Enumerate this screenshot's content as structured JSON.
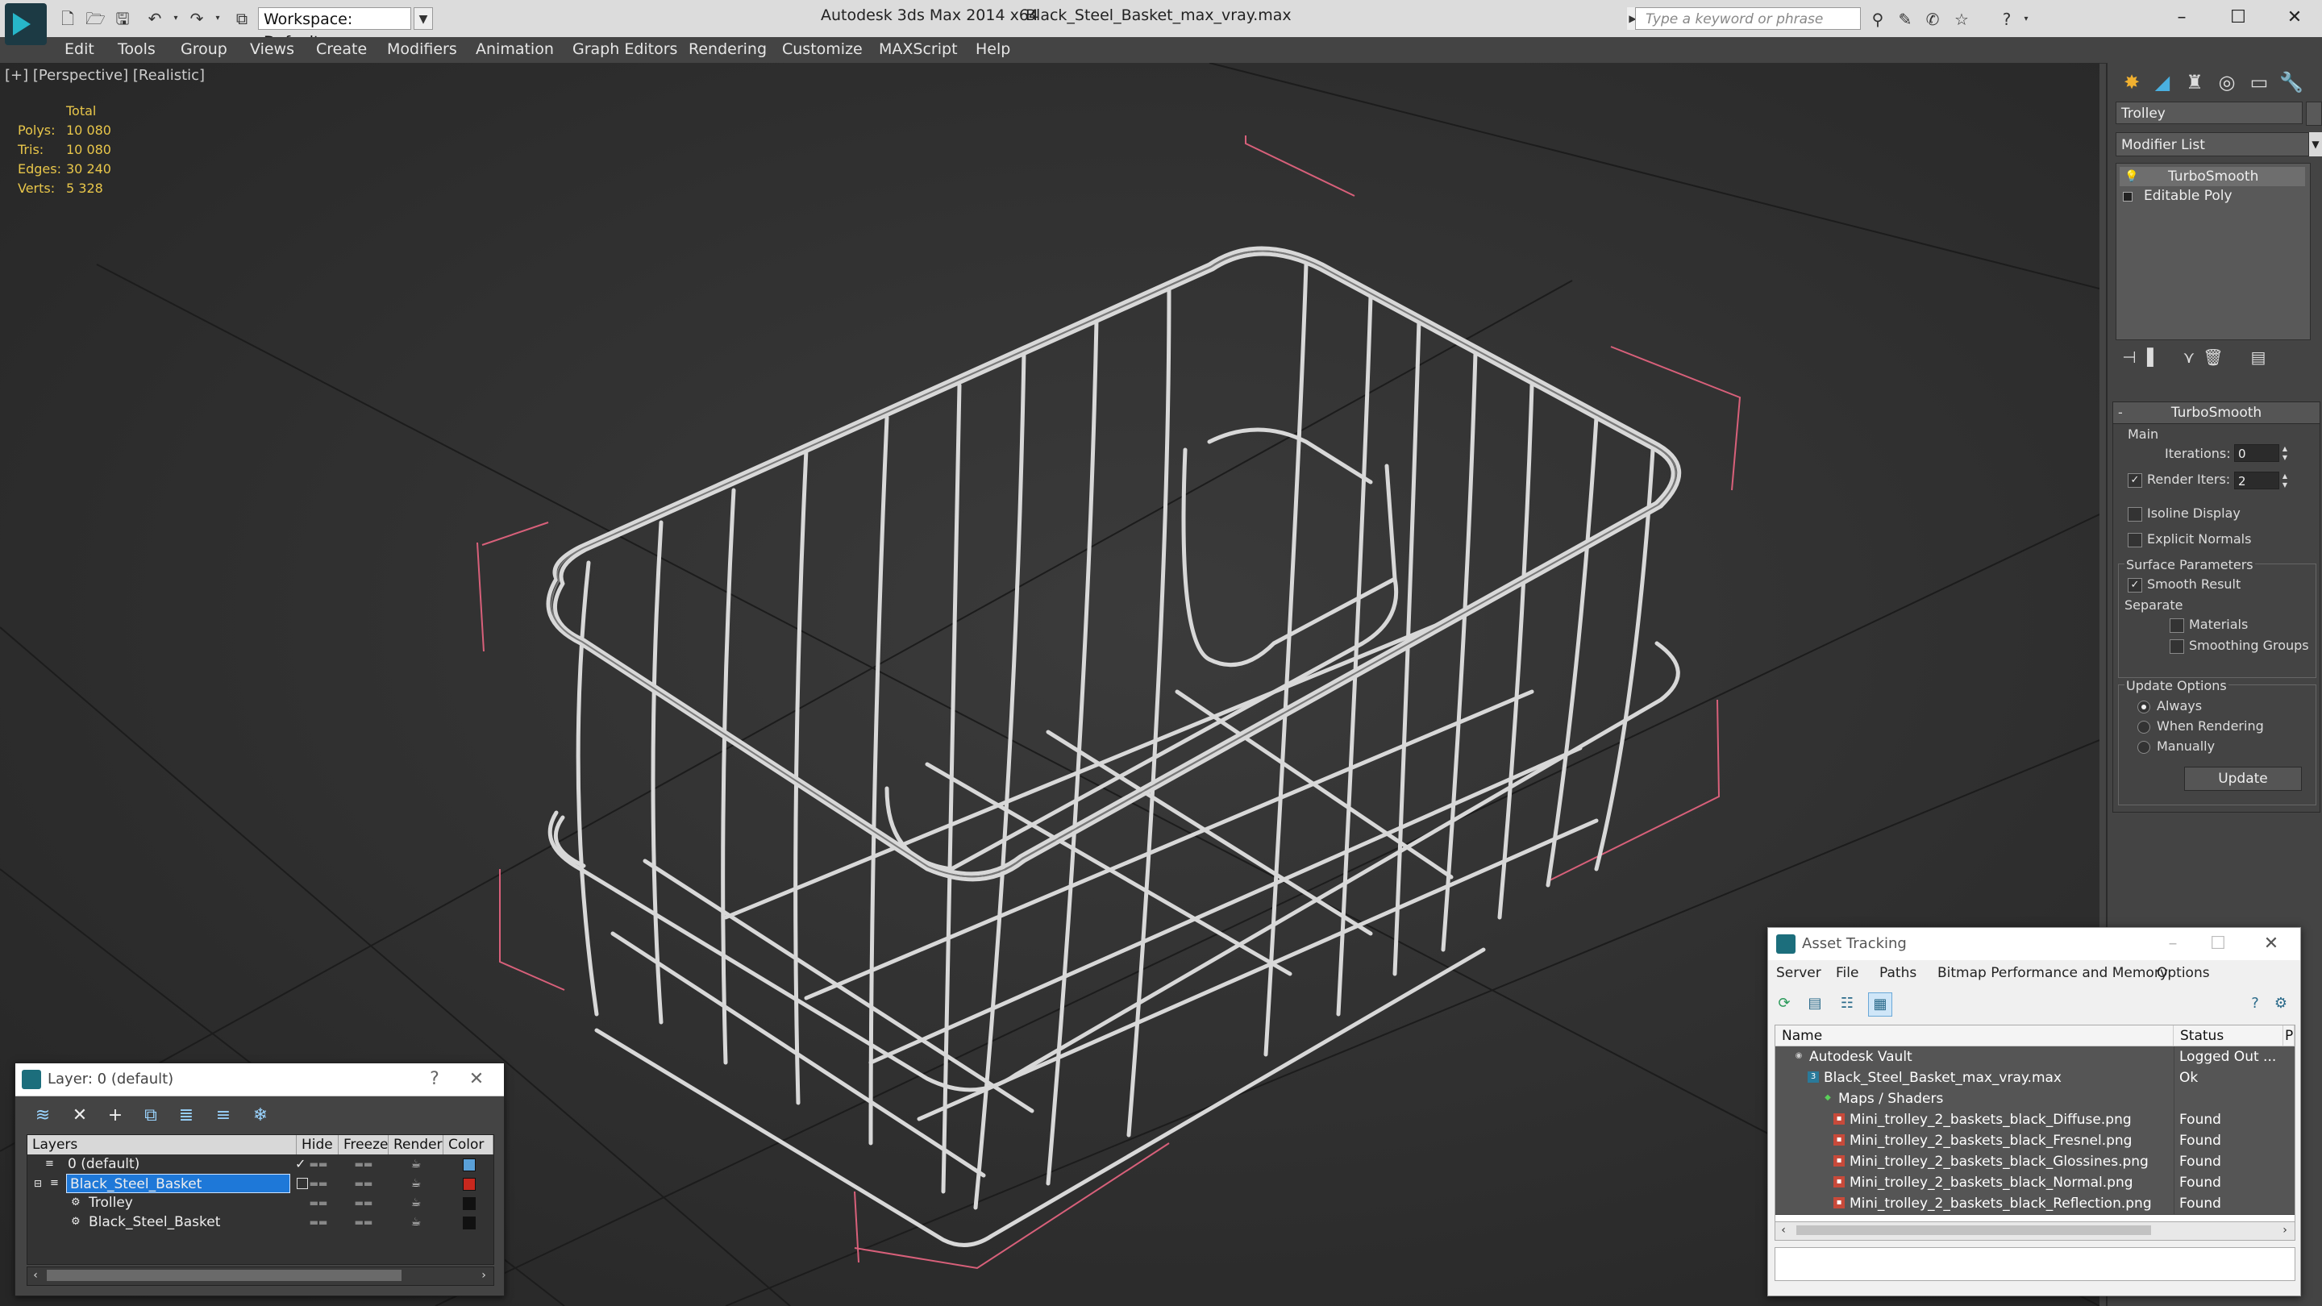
{
  "titlebar": {
    "workspace": "Workspace: Default",
    "app_title": "Autodesk 3ds Max 2014 x64",
    "file_title": "Black_Steel_Basket_max_vray.max",
    "search_placeholder": "Type a keyword or phrase",
    "window_controls": [
      "–",
      "☐",
      "✕"
    ]
  },
  "menu": [
    "Edit",
    "Tools",
    "Group",
    "Views",
    "Create",
    "Modifiers",
    "Animation",
    "Graph Editors",
    "Rendering",
    "Customize",
    "MAXScript",
    "Help"
  ],
  "viewport": {
    "label": "[+] [Perspective] [Realistic]",
    "stats_header": "Total",
    "stats": [
      {
        "label": "Polys:",
        "value": "10 080"
      },
      {
        "label": "Tris:",
        "value": "10 080"
      },
      {
        "label": "Edges:",
        "value": "30 240"
      },
      {
        "label": "Verts:",
        "value": "5 328"
      }
    ]
  },
  "command_panel": {
    "object_name": "Trolley",
    "modifier_list": "Modifier List",
    "stack": [
      "TurboSmooth",
      "Editable Poly"
    ],
    "rollout_title": "TurboSmooth",
    "main_label": "Main",
    "iterations_label": "Iterations:",
    "iterations_value": "0",
    "render_iters_label": "Render Iters:",
    "render_iters_value": "2",
    "isoline_label": "Isoline Display",
    "explicit_normals_label": "Explicit Normals",
    "surface_params_label": "Surface Parameters",
    "smooth_result_label": "Smooth Result",
    "separate_label": "Separate",
    "materials_label": "Materials",
    "smoothing_groups_label": "Smoothing Groups",
    "update_options_label": "Update Options",
    "always_label": "Always",
    "when_rendering_label": "When Rendering",
    "manually_label": "Manually",
    "update_button": "Update"
  },
  "layer_dialog": {
    "title": "Layer: 0 (default)",
    "help": "?",
    "close": "✕",
    "columns": [
      "Layers",
      "Hide",
      "Freeze",
      "Render",
      "Color"
    ],
    "rows": [
      {
        "name": "0 (default)",
        "color": "#5aa0d8"
      },
      {
        "name": "Black_Steel_Basket",
        "color": "#c8281e"
      },
      {
        "name": "Trolley",
        "color": "#111111"
      },
      {
        "name": "Black_Steel_Basket",
        "color": "#111111"
      }
    ]
  },
  "asset_dialog": {
    "title": "Asset Tracking",
    "menu": [
      "Server",
      "File",
      "Paths",
      "Bitmap Performance and Memory",
      "Options"
    ],
    "columns": [
      "Name",
      "Status",
      "P"
    ],
    "rows": [
      {
        "name": "Autodesk Vault",
        "status": "Logged Out ..."
      },
      {
        "name": "Black_Steel_Basket_max_vray.max",
        "status": "Ok"
      },
      {
        "name": "Maps / Shaders",
        "status": ""
      },
      {
        "name": "Mini_trolley_2_baskets_black_Diffuse.png",
        "status": "Found"
      },
      {
        "name": "Mini_trolley_2_baskets_black_Fresnel.png",
        "status": "Found"
      },
      {
        "name": "Mini_trolley_2_baskets_black_Glossines.png",
        "status": "Found"
      },
      {
        "name": "Mini_trolley_2_baskets_black_Normal.png",
        "status": "Found"
      },
      {
        "name": "Mini_trolley_2_baskets_black_Reflection.png",
        "status": "Found"
      }
    ]
  }
}
